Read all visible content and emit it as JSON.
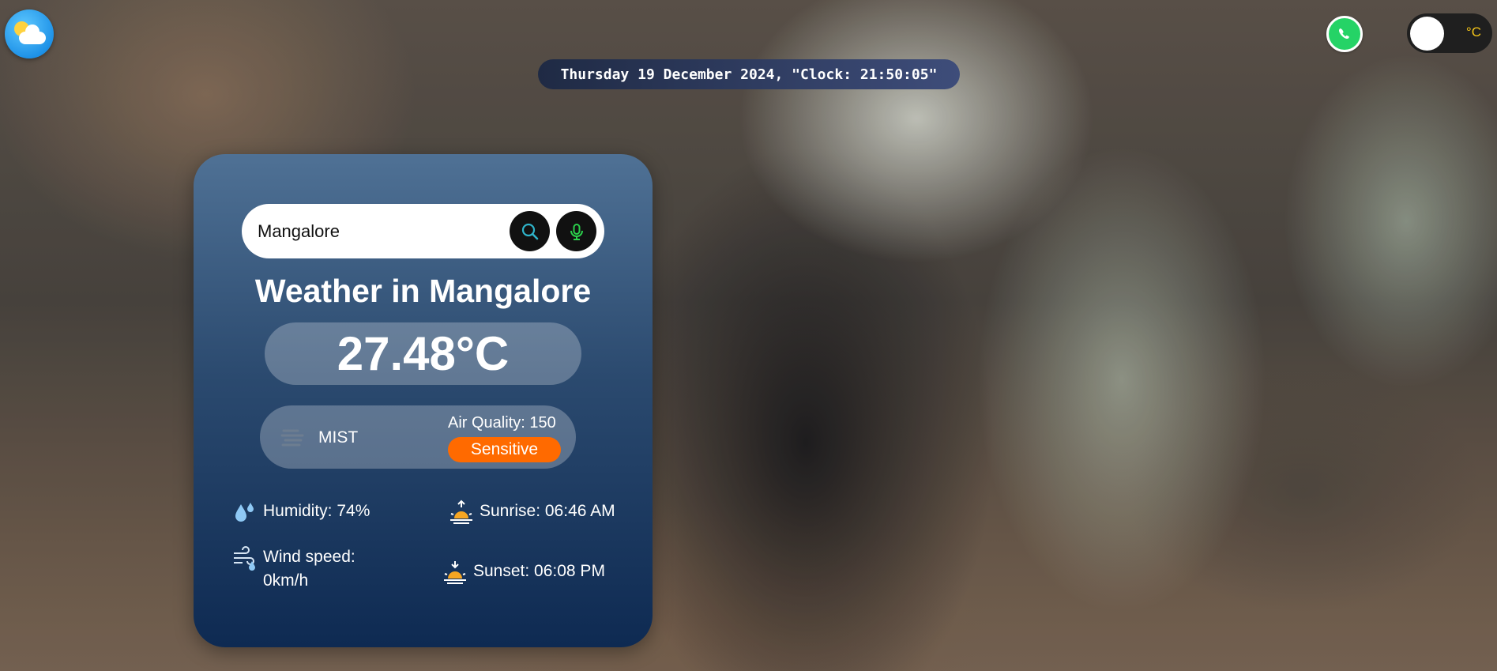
{
  "header": {
    "logo_icon": "weather-sun-cloud-icon",
    "datetime": "Thursday 19 December 2024, \"Clock: 21:50:05\"",
    "whatsapp_icon": "whatsapp-icon",
    "unit_toggle_label": "°C"
  },
  "search": {
    "value": "Mangalore",
    "search_icon": "search-icon",
    "mic_icon": "microphone-icon"
  },
  "weather": {
    "title": "Weather in Mangalore",
    "temperature": "27.48°C",
    "condition": "MIST",
    "condition_icon": "mist-icon",
    "air_quality": "Air Quality: 150",
    "air_quality_level": "Sensitive",
    "humidity": "Humidity: 74%",
    "sunrise": "Sunrise: 06:46 AM",
    "wind_speed_line1": "Wind speed:",
    "wind_speed_line2": "0km/h",
    "sunset": "Sunset: 06:08 PM"
  },
  "colors": {
    "air_quality_badge": "#ff6a00",
    "toggle_text": "#f5c518",
    "card_top": "#4f7195",
    "card_bottom": "#0e2a52"
  }
}
